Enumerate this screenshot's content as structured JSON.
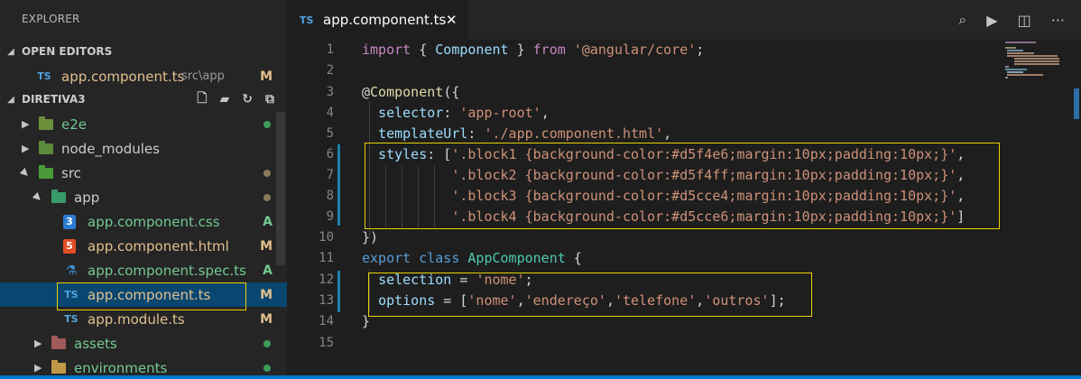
{
  "sidebar": {
    "title": "EXPLORER",
    "open_editors": {
      "heading": "OPEN EDITORS",
      "items": [
        {
          "icon": "TS",
          "name": "app.component.ts",
          "path": "src\\app",
          "status": "M"
        }
      ]
    },
    "project": {
      "heading": "DIRETIVA3",
      "tree": [
        {
          "name": "e2e",
          "kind": "folder",
          "status_color": "#3d9e5a"
        },
        {
          "name": "node_modules",
          "kind": "folder",
          "status_color": ""
        },
        {
          "name": "src",
          "kind": "folder",
          "status_color": "#8a7a5a"
        },
        {
          "name": "app",
          "kind": "folder",
          "status_color": "#8a7a5a"
        },
        {
          "name": "app.component.css",
          "kind": "css",
          "icon": "3",
          "status": "A"
        },
        {
          "name": "app.component.html",
          "kind": "html",
          "icon": "5",
          "status": "M"
        },
        {
          "name": "app.component.spec.ts",
          "kind": "spec",
          "status": "A"
        },
        {
          "name": "app.component.ts",
          "kind": "ts",
          "icon": "TS",
          "status": "M"
        },
        {
          "name": "app.module.ts",
          "kind": "ts",
          "icon": "TS",
          "status": "M"
        },
        {
          "name": "assets",
          "kind": "folder",
          "status_color": "#3d9e5a"
        },
        {
          "name": "environments",
          "kind": "folder",
          "status_color": "#3d9e5a"
        }
      ]
    }
  },
  "tab": {
    "icon": "TS",
    "title": "app.component.ts",
    "close": "✕"
  },
  "editor": {
    "line_numbers": [
      "1",
      "2",
      "3",
      "4",
      "5",
      "6",
      "7",
      "8",
      "9",
      "10",
      "11",
      "12",
      "13",
      "14",
      "15"
    ],
    "lines": [
      "import { Component } from '@angular/core';",
      "",
      "@Component({",
      "  selector: 'app-root',",
      "  templateUrl: './app.component.html',",
      "  styles: ['.block1 {background-color:#d5f4e6;margin:10px;padding:10px;}',",
      "           '.block2 {background-color:#d5f4ff;margin:10px;padding:10px;}',",
      "           '.block3 {background-color:#d5cce4;margin:10px;padding:10px;}',",
      "           '.block4 {background-color:#d5cce6;margin:10px;padding:10px;}']",
      "})",
      "export class AppComponent {",
      "  selection = 'nome';",
      "  options = ['nome','endereço','telefone','outros'];",
      "}",
      ""
    ]
  },
  "colors": {
    "accent": "#007acc",
    "highlight": "#e6d200",
    "status_modified": "#e2c08d",
    "status_added": "#73c991"
  }
}
